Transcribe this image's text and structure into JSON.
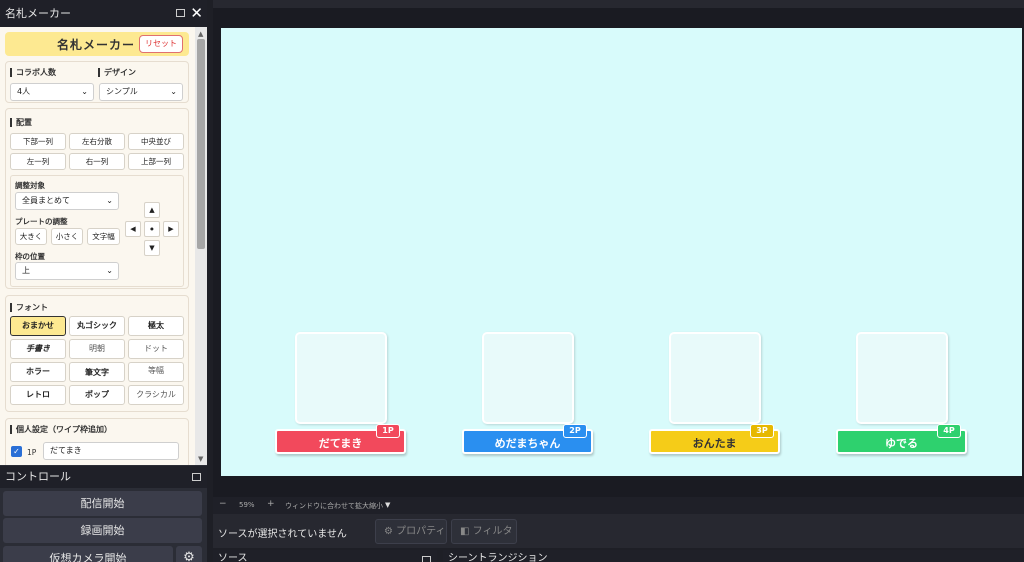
{
  "dock": {
    "title": "名札メーカー",
    "header_title": "名札メーカー",
    "reset_label": "リセット",
    "collab": {
      "label": "コラボ人数",
      "value": "4人"
    },
    "design": {
      "label": "デザイン",
      "value": "シンプル"
    },
    "layout": {
      "label": "配置",
      "buttons": [
        "下部一列",
        "左右分散",
        "中央並び",
        "左一列",
        "右一列",
        "上部一列"
      ]
    },
    "adjust": {
      "target_label": "調整対象",
      "target_value": "全員まとめて",
      "plate_label": "プレートの調整",
      "plate_buttons": [
        "大きく",
        "小さく",
        "文字幅"
      ],
      "frame_pos_label": "枠の位置",
      "frame_pos_value": "上",
      "arrows": {
        "up": "▲",
        "left": "◀",
        "center": "●",
        "right": "▶",
        "down": "▼"
      }
    },
    "font": {
      "label": "フォント",
      "buttons": [
        "おまかせ",
        "丸ゴシック",
        "極太",
        "手書き",
        "明朝",
        "ドット",
        "ホラー",
        "筆文字",
        "等幅",
        "レトロ",
        "ポップ",
        "クラシカル"
      ],
      "selected": "おまかせ"
    },
    "personal": {
      "label": "個人設定（ワイプ枠追加）",
      "player_tag": "1P",
      "name_value": "だてまき"
    }
  },
  "controls": {
    "title": "コントロール",
    "buttons": [
      "配信開始",
      "録画開始",
      "仮想カメラ開始"
    ]
  },
  "preview": {
    "players": [
      {
        "name": "だてまき",
        "tag": "1P",
        "color": "#f2495c",
        "badge_color": "#f2495c"
      },
      {
        "name": "めだまちゃん",
        "tag": "2P",
        "color": "#2a8ff0",
        "badge_color": "#2a8ff0"
      },
      {
        "name": "おんたま",
        "tag": "3P",
        "color": "#f5cc18",
        "badge_color": "#e6b800",
        "text_color": "#333333"
      },
      {
        "name": "ゆでる",
        "tag": "4P",
        "color": "#2ed16e",
        "badge_color": "#2ed16e"
      }
    ]
  },
  "zoombar": {
    "minus": "−",
    "zoom": "59%",
    "plus": "+",
    "fit": "ウィンドウに合わせて拡大縮小",
    "dropdown": "▼"
  },
  "context": {
    "no_source": "ソースが選択されていません",
    "properties": "プロパティ",
    "filters": "フィルタ"
  },
  "bottom": {
    "sources": "ソース",
    "transitions": "シーントランジション"
  },
  "icons": {
    "chevron": "⌄",
    "gear": "⚙",
    "filter": "◧",
    "check": "✓",
    "close": "✕"
  }
}
